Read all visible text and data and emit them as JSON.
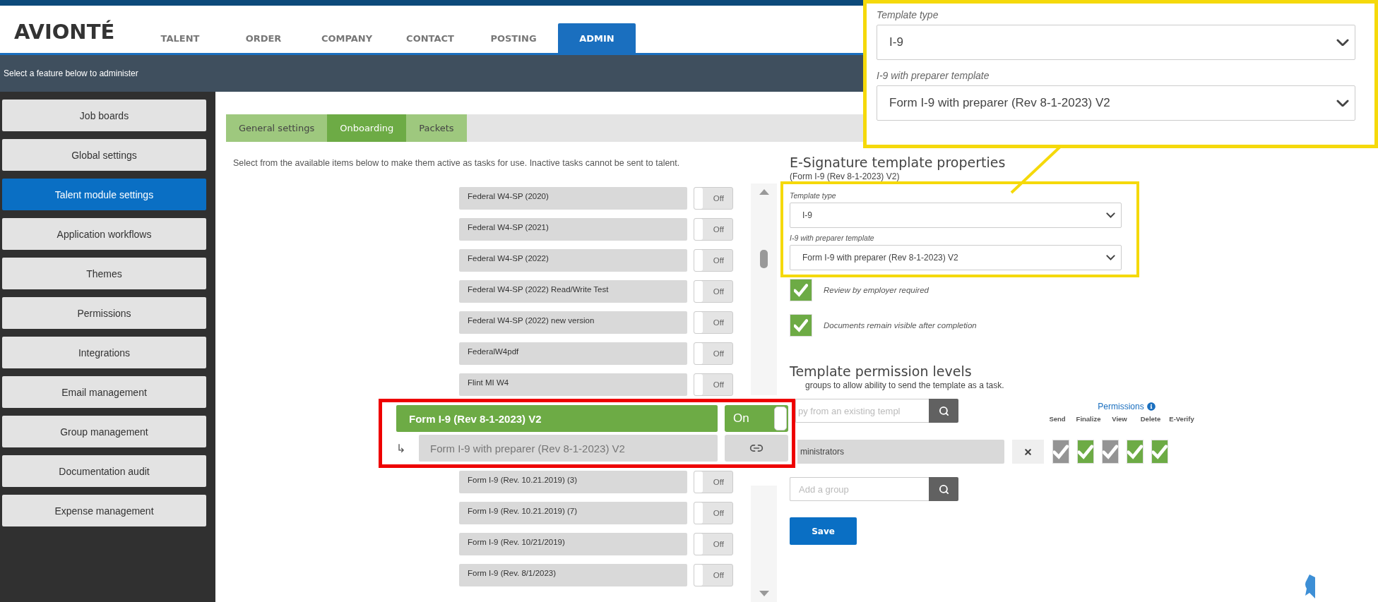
{
  "header": {
    "logo": "AVIONTÉ",
    "nav": [
      {
        "label": "TALENT",
        "selected": false
      },
      {
        "label": "ORDER",
        "selected": false
      },
      {
        "label": "COMPANY",
        "selected": false
      },
      {
        "label": "CONTACT",
        "selected": false
      },
      {
        "label": "POSTING",
        "selected": false
      },
      {
        "label": "ADMIN",
        "selected": true
      }
    ]
  },
  "subbar": "Select a feature below to administer",
  "sidebar": [
    {
      "label": "Job boards",
      "selected": false
    },
    {
      "label": "Global settings",
      "selected": false
    },
    {
      "label": "Talent module settings",
      "selected": true
    },
    {
      "label": "Application workflows",
      "selected": false
    },
    {
      "label": "Themes",
      "selected": false
    },
    {
      "label": "Permissions",
      "selected": false
    },
    {
      "label": "Integrations",
      "selected": false
    },
    {
      "label": "Email management",
      "selected": false
    },
    {
      "label": "Group management",
      "selected": false
    },
    {
      "label": "Documentation audit",
      "selected": false
    },
    {
      "label": "Expense management",
      "selected": false
    }
  ],
  "tabs": [
    {
      "label": "General settings",
      "selected": false
    },
    {
      "label": "Onboarding",
      "selected": true
    },
    {
      "label": "Packets",
      "selected": false
    }
  ],
  "instructions": "Select from the available items below to make them active as tasks for use. Inactive tasks cannot be sent to talent.",
  "tasks": [
    {
      "name": "Federal W4-SP (2020)",
      "on": false,
      "toggle": "Off"
    },
    {
      "name": "Federal W4-SP (2021)",
      "on": false,
      "toggle": "Off"
    },
    {
      "name": "Federal W4-SP (2022)",
      "on": false,
      "toggle": "Off"
    },
    {
      "name": "Federal W4-SP (2022) Read/Write Test",
      "on": false,
      "toggle": "Off"
    },
    {
      "name": "Federal W4-SP (2022) new version",
      "on": false,
      "toggle": "Off"
    },
    {
      "name": "FederalW4pdf",
      "on": false,
      "toggle": "Off"
    },
    {
      "name": "Flint MI W4",
      "on": false,
      "toggle": "Off"
    }
  ],
  "highlight": {
    "task": {
      "name": "Form I-9 (Rev 8-1-2023) V2",
      "on": true,
      "toggle": "On"
    },
    "linked": {
      "arrow": "↳",
      "name": "Form I-9 with preparer (Rev 8-1-2023) V2"
    }
  },
  "tasks_after": [
    {
      "name": "Form I-9 (Rev. 10.21.2019) (3)",
      "on": false,
      "toggle": "Off"
    },
    {
      "name": "Form I-9 (Rev. 10.21.2019) (7)",
      "on": false,
      "toggle": "Off"
    },
    {
      "name": "Form I-9 (Rev. 10/21/2019)",
      "on": false,
      "toggle": "Off"
    },
    {
      "name": "Form I-9 (Rev. 8/1/2023)",
      "on": false,
      "toggle": "Off"
    }
  ],
  "properties": {
    "title": "E-Signature template properties",
    "subtitle": "(Form I-9 (Rev 8-1-2023) V2)",
    "fields": [
      {
        "label": "Template type",
        "value": "I-9"
      },
      {
        "label": "I-9 with preparer template",
        "value": "Form I-9 with preparer (Rev 8-1-2023) V2"
      }
    ],
    "options": [
      {
        "label": "Review by employer required",
        "checked": true
      },
      {
        "label": "Documents remain visible after completion",
        "checked": true
      }
    ]
  },
  "zoom_callout": {
    "fields": [
      {
        "label": "Template type",
        "value": "I-9"
      },
      {
        "label": "I-9 with preparer template",
        "value": "Form I-9 with preparer (Rev 8-1-2023) V2"
      }
    ]
  },
  "permissions": {
    "title": "Template permission levels",
    "description": "groups to allow ability to send the template as a task.",
    "copy_placeholder": "py from an existing templ",
    "header": "Permissions",
    "columns": [
      "Send",
      "Finalize",
      "View",
      "Delete",
      "E-Verify"
    ],
    "groups": [
      {
        "name": "ministrators",
        "rights": [
          {
            "checked": false
          },
          {
            "checked": true
          },
          {
            "checked": false
          },
          {
            "checked": true
          },
          {
            "checked": true
          }
        ]
      }
    ],
    "add_placeholder": "Add a group",
    "save": "Save"
  }
}
